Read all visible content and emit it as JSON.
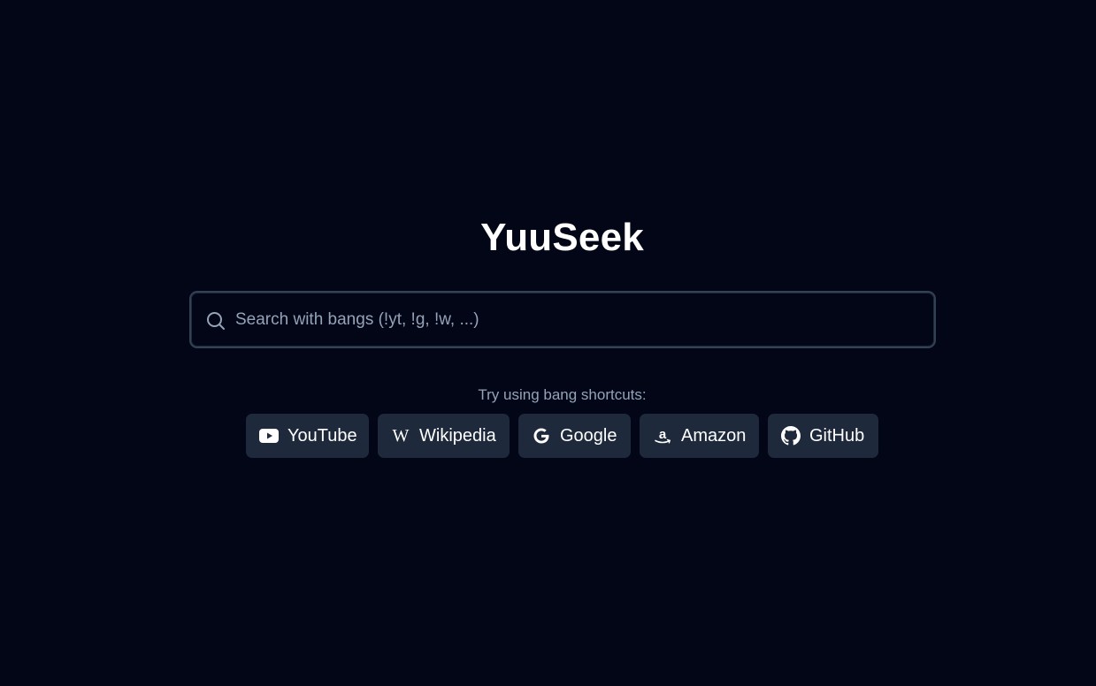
{
  "app": {
    "title": "YuuSeek"
  },
  "search": {
    "placeholder": "Search with bangs (!yt, !g, !w, ...)",
    "value": "",
    "icon": "search-icon"
  },
  "hint": "Try using bang shortcuts:",
  "shortcuts": [
    {
      "label": "YouTube",
      "icon": "youtube-icon"
    },
    {
      "label": "Wikipedia",
      "icon": "wikipedia-icon"
    },
    {
      "label": "Google",
      "icon": "google-icon"
    },
    {
      "label": "Amazon",
      "icon": "amazon-icon"
    },
    {
      "label": "GitHub",
      "icon": "github-icon"
    }
  ],
  "colors": {
    "background": "#020617",
    "chip": "#1e293b",
    "border": "#334155",
    "muted_text": "#94a3b8"
  }
}
